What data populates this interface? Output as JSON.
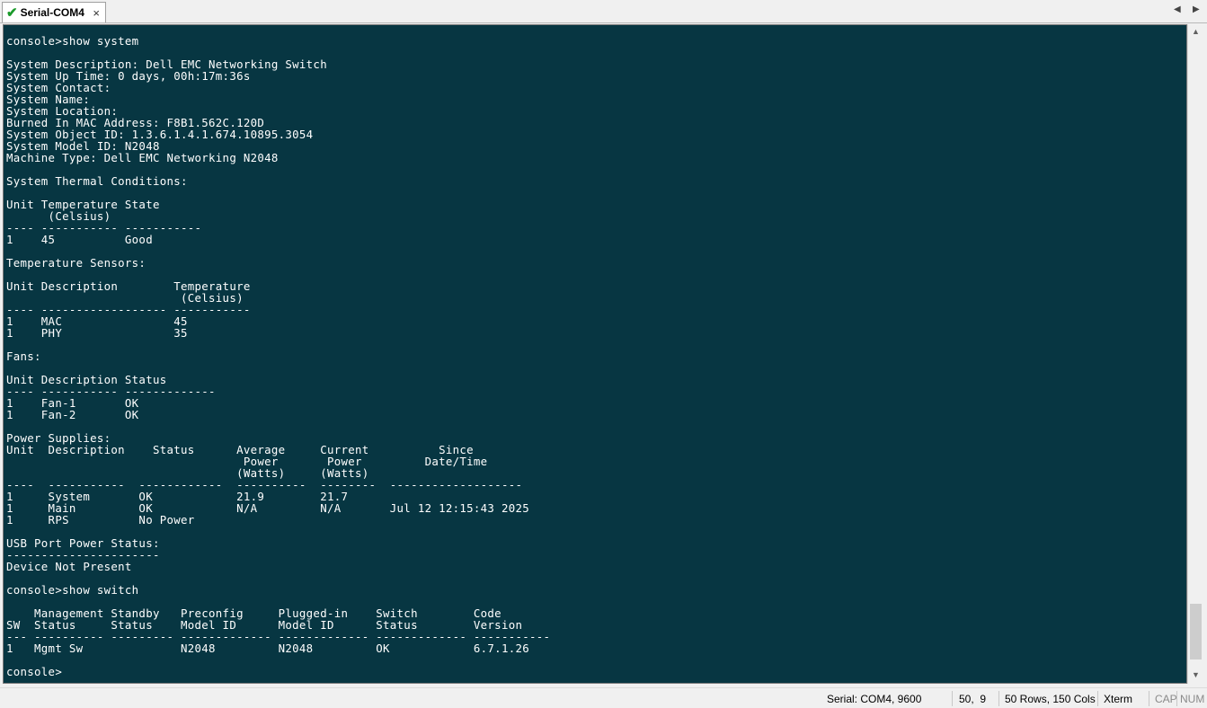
{
  "tab": {
    "title": "Serial-COM4",
    "close_glyph": "×",
    "status_icon": "check-icon"
  },
  "tab_nav": {
    "prev_glyph": "◀",
    "next_glyph": "▶"
  },
  "terminal": {
    "background": "#073642",
    "foreground": "#ffffff",
    "lines": [
      "console>show system",
      "",
      "System Description: Dell EMC Networking Switch",
      "System Up Time: 0 days, 00h:17m:36s",
      "System Contact:",
      "System Name:",
      "System Location:",
      "Burned In MAC Address: F8B1.562C.120D",
      "System Object ID: 1.3.6.1.4.1.674.10895.3054",
      "System Model ID: N2048",
      "Machine Type: Dell EMC Networking N2048",
      "",
      "System Thermal Conditions:",
      "",
      "Unit Temperature State",
      "      (Celsius)",
      "---- ----------- -----------",
      "1    45          Good",
      "",
      "Temperature Sensors:",
      "",
      "Unit Description        Temperature",
      "                         (Celsius)",
      "---- ------------------ -----------",
      "1    MAC                45",
      "1    PHY                35",
      "",
      "Fans:",
      "",
      "Unit Description Status",
      "---- ----------- -------------",
      "1    Fan-1       OK",
      "1    Fan-2       OK",
      "",
      "Power Supplies:",
      "Unit  Description    Status      Average     Current          Since",
      "                                  Power       Power         Date/Time",
      "                                 (Watts)     (Watts)",
      "----  -----------  ------------  ----------  --------  -------------------",
      "1     System       OK            21.9        21.7",
      "1     Main         OK            N/A         N/A       Jul 12 12:15:43 2025",
      "1     RPS          No Power",
      "",
      "USB Port Power Status:",
      "----------------------",
      "Device Not Present",
      "",
      "console>show switch",
      "",
      "    Management Standby   Preconfig     Plugged-in    Switch        Code",
      "SW  Status     Status    Model ID      Model ID      Status        Version",
      "--- ---------- --------- ------------- ------------- ------------- -----------",
      "1   Mgmt Sw              N2048         N2048         OK            6.7.1.26",
      "",
      "console>"
    ]
  },
  "scrollbar": {
    "up_glyph": "▲",
    "down_glyph": "▼"
  },
  "status_bar": {
    "connection": "Serial: COM4, 9600",
    "cursor_position": "50,  9",
    "dimensions": "50 Rows, 150 Cols",
    "terminal_type": "Xterm",
    "caps_lock": "CAP",
    "num_lock": "NUM"
  }
}
